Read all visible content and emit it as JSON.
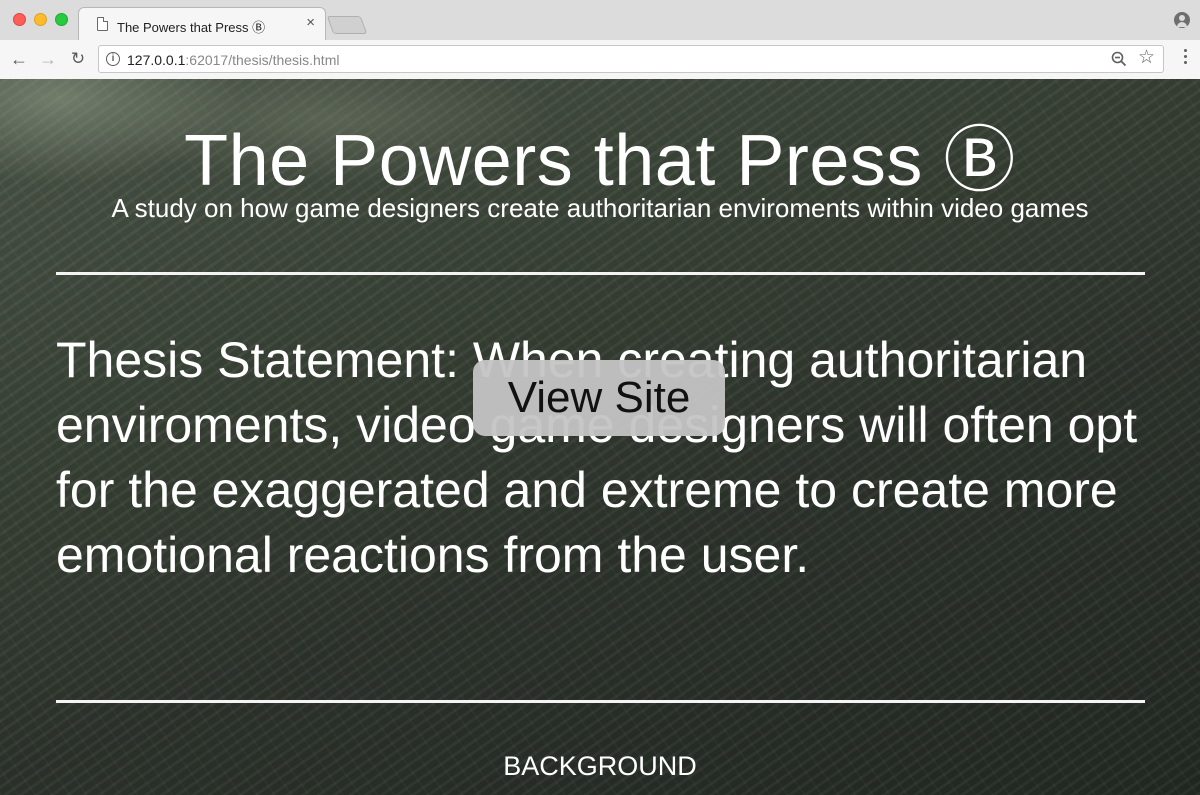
{
  "browser": {
    "tab_title": "The Powers that Press Ⓑ",
    "tab_close": "×",
    "url_host": "127.0.0.1",
    "url_rest": ":62017/thesis/thesis.html",
    "back_icon": "←",
    "forward_icon": "→",
    "reload_icon": "↻",
    "info_icon": "i",
    "star_icon": "☆"
  },
  "page": {
    "title": "The Powers that Press Ⓑ",
    "subtitle": "A study on how game designers create authoritarian enviroments within video games",
    "thesis": "Thesis Statement: When creating authoritarian enviroments, video game designers will often opt for the exaggerated and extreme to create more emotional reactions from the user.",
    "view_site_button": "View Site",
    "section_heading": "BACKGROUND"
  },
  "colors": {
    "text": "#ffffff",
    "button_bg": "#c4c4c4",
    "background": "#2c332b"
  }
}
